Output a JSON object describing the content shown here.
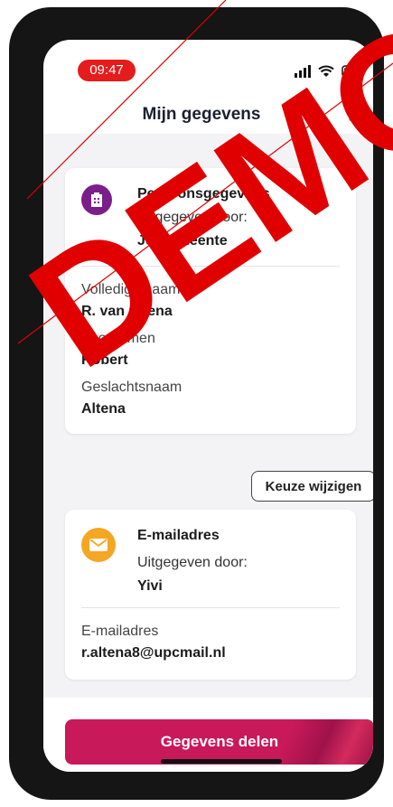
{
  "status_bar": {
    "time": "09:47"
  },
  "header": {
    "title": "Mijn gegevens",
    "close_label": "✕"
  },
  "cards": [
    {
      "title": "Persoonsgegevens",
      "issuer_label": "Uitgegeven door:",
      "issuer": "Je Gemeente",
      "icon": "building-icon",
      "attributes": [
        {
          "label": "Volledige naam",
          "value": "R. van Altena"
        },
        {
          "label": "Voornamen",
          "value": "Robert"
        },
        {
          "label": "Geslachtsnaam",
          "value": "Altena"
        }
      ]
    },
    {
      "title": "E-mailadres",
      "issuer_label": "Uitgegeven door:",
      "issuer": "Yivi",
      "icon": "mail-icon",
      "attributes": [
        {
          "label": "E-mailadres",
          "value": "r.altena8@upcmail.nl"
        }
      ]
    }
  ],
  "change_choice_label": "Keuze wijzigen",
  "share_button_label": "Gegevens delen",
  "watermark": "DEMO",
  "colors": {
    "accent": "#c8195a",
    "watermark": "#e00000",
    "status_pill": "#e51c1c"
  }
}
